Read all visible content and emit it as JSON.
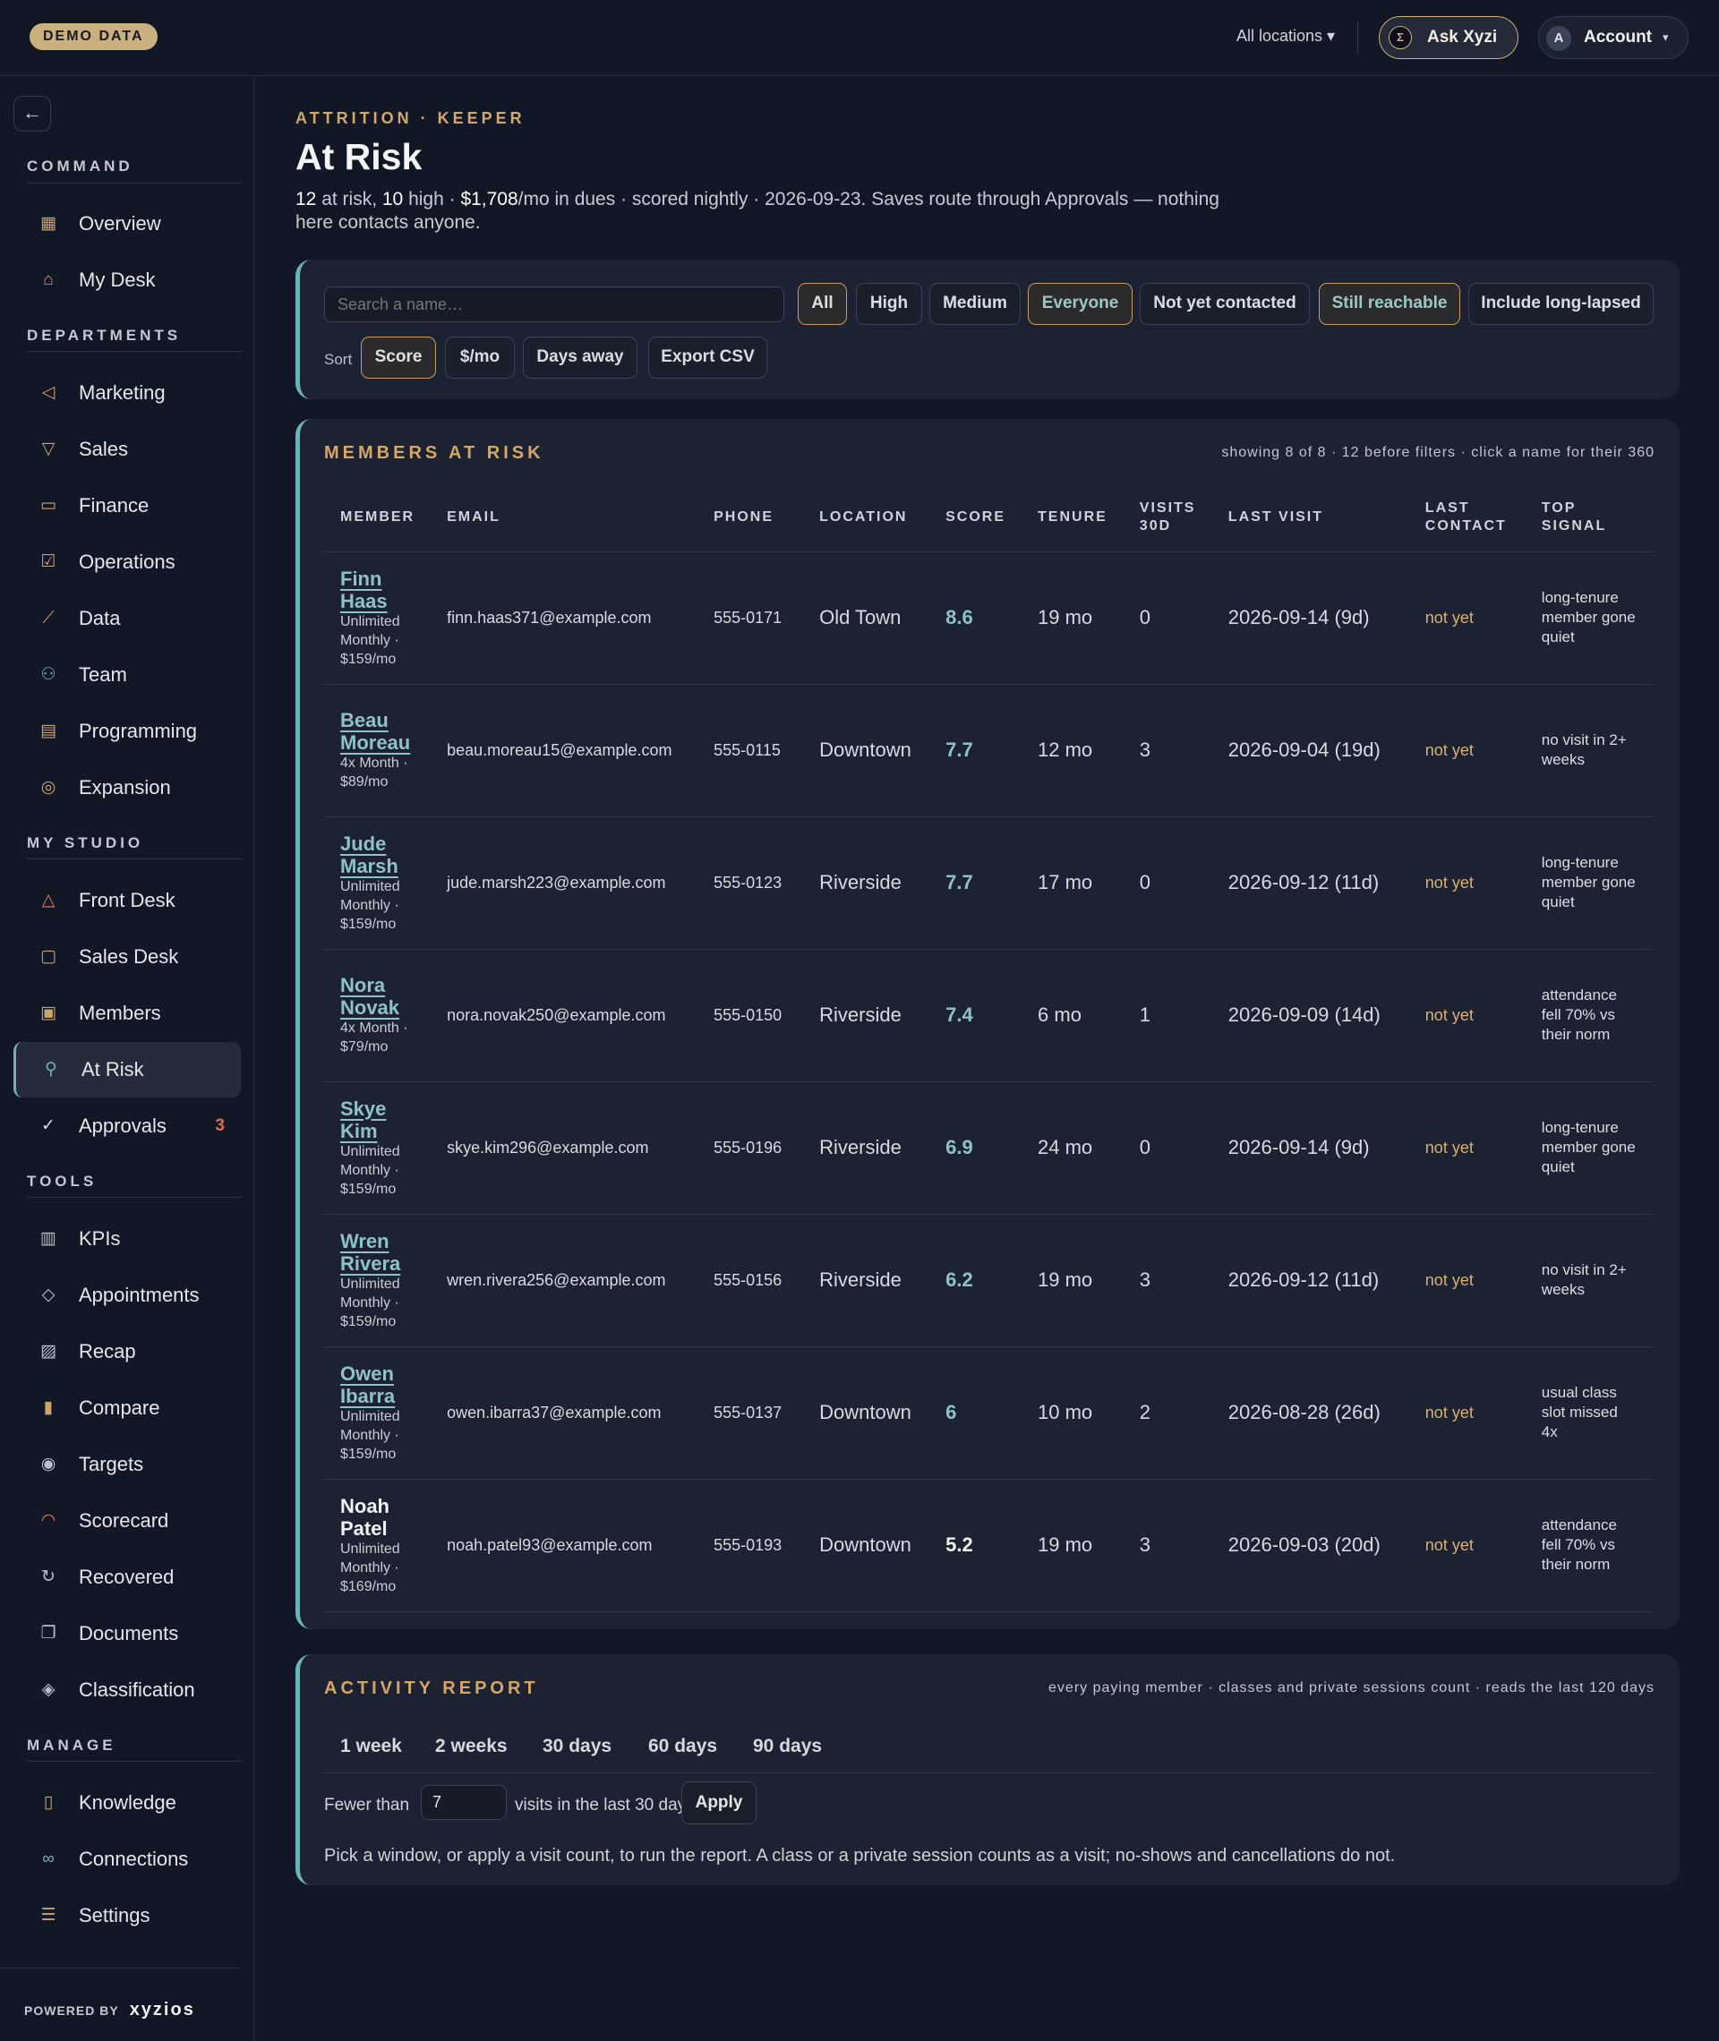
{
  "topbar": {
    "demo_badge": "DEMO DATA",
    "locations": "All locations ▾",
    "ask_label": "Ask Xyzi",
    "account_initial": "A",
    "account_label": "Account",
    "account_caret": "▾"
  },
  "sidebar": {
    "back_icon": "←",
    "sections": {
      "command": "COMMAND",
      "departments": "DEPARTMENTS",
      "my_studio": "MY STUDIO",
      "tools": "TOOLS",
      "manage": "MANAGE"
    },
    "items": [
      {
        "label": "Overview",
        "icon": "grid-icon"
      },
      {
        "label": "My Desk",
        "icon": "inbox-icon"
      },
      {
        "label": "Marketing",
        "icon": "megaphone-icon"
      },
      {
        "label": "Sales",
        "icon": "funnel-icon"
      },
      {
        "label": "Finance",
        "icon": "banknote-icon"
      },
      {
        "label": "Operations",
        "icon": "clipboard-check-icon"
      },
      {
        "label": "Data",
        "icon": "line-chart-icon"
      },
      {
        "label": "Team",
        "icon": "users-icon"
      },
      {
        "label": "Programming",
        "icon": "calendar-icon"
      },
      {
        "label": "Expansion",
        "icon": "compass-icon"
      },
      {
        "label": "Front Desk",
        "icon": "bell-icon"
      },
      {
        "label": "Sales Desk",
        "icon": "chat-icon"
      },
      {
        "label": "Members",
        "icon": "id-card-icon"
      },
      {
        "label": "At Risk",
        "icon": "user-alert-icon"
      },
      {
        "label": "Approvals",
        "icon": "check-circle-icon",
        "badge": "3"
      },
      {
        "label": "KPIs",
        "icon": "bar-chart-icon"
      },
      {
        "label": "Appointments",
        "icon": "layers-icon"
      },
      {
        "label": "Recap",
        "icon": "trend-file-icon"
      },
      {
        "label": "Compare",
        "icon": "columns-chart-icon"
      },
      {
        "label": "Targets",
        "icon": "target-icon"
      },
      {
        "label": "Scorecard",
        "icon": "gauge-icon"
      },
      {
        "label": "Recovered",
        "icon": "refresh-icon"
      },
      {
        "label": "Documents",
        "icon": "documents-icon"
      },
      {
        "label": "Classification",
        "icon": "tag-icon"
      },
      {
        "label": "Knowledge",
        "icon": "book-icon"
      },
      {
        "label": "Connections",
        "icon": "link-icon"
      },
      {
        "label": "Settings",
        "icon": "sliders-icon"
      }
    ],
    "powered_by": "POWERED BY",
    "brand": "xyzios"
  },
  "header": {
    "eyebrow": "ATTRITION · KEEPER",
    "title": "At Risk",
    "subtitle_a": "12",
    "subtitle_b": " at risk, ",
    "subtitle_c": "10",
    "subtitle_d": " high · ",
    "subtitle_e": "$1,708",
    "subtitle_f": "/mo in dues · scored nightly · 2026-09-23. Saves route through Approvals — nothing here contacts anyone."
  },
  "filters": {
    "search_placeholder": "Search a name…",
    "chips": [
      "All",
      "High",
      "Medium",
      "Everyone",
      "Not yet contacted",
      "Still reachable",
      "Include long-lapsed"
    ],
    "sort_label": "Sort",
    "sort_chips": [
      "Score",
      "$/mo",
      "Days away",
      "Export CSV"
    ]
  },
  "members": {
    "title": "MEMBERS AT RISK",
    "note": "showing 8 of 8 · 12 before filters · click a name for their 360",
    "columns": [
      "MEMBER",
      "EMAIL",
      "PHONE",
      "LOCATION",
      "SCORE",
      "TENURE",
      "VISITS 30D",
      "LAST VISIT",
      "LAST CONTACT",
      "TOP SIGNAL"
    ],
    "rows": [
      {
        "first": "Finn",
        "last": "Haas",
        "plan": "Unlimited Monthly · $159/mo",
        "email": "finn.haas371@example.com",
        "phone": "555-0171",
        "location": "Old Town",
        "score": "8.6",
        "tenure": "19 mo",
        "visits": "0",
        "last_visit": "2026-09-14 (9d)",
        "last_contact": "not yet",
        "signal": "long-tenure member gone quiet"
      },
      {
        "first": "Beau",
        "last": "Moreau",
        "plan": "4x Month · $89/mo",
        "email": "beau.moreau15@example.com",
        "phone": "555-0115",
        "location": "Downtown",
        "score": "7.7",
        "tenure": "12 mo",
        "visits": "3",
        "last_visit": "2026-09-04 (19d)",
        "last_contact": "not yet",
        "signal": "no visit in 2+ weeks"
      },
      {
        "first": "Jude",
        "last": "Marsh",
        "plan": "Unlimited Monthly · $159/mo",
        "email": "jude.marsh223@example.com",
        "phone": "555-0123",
        "location": "Riverside",
        "score": "7.7",
        "tenure": "17 mo",
        "visits": "0",
        "last_visit": "2026-09-12 (11d)",
        "last_contact": "not yet",
        "signal": "long-tenure member gone quiet"
      },
      {
        "first": "Nora",
        "last": "Novak",
        "plan": "4x Month · $79/mo",
        "email": "nora.novak250@example.com",
        "phone": "555-0150",
        "location": "Riverside",
        "score": "7.4",
        "tenure": "6 mo",
        "visits": "1",
        "last_visit": "2026-09-09 (14d)",
        "last_contact": "not yet",
        "signal": "attendance fell 70% vs their norm"
      },
      {
        "first": "Skye",
        "last": "Kim",
        "plan": "Unlimited Monthly · $159/mo",
        "email": "skye.kim296@example.com",
        "phone": "555-0196",
        "location": "Riverside",
        "score": "6.9",
        "tenure": "24 mo",
        "visits": "0",
        "last_visit": "2026-09-14 (9d)",
        "last_contact": "not yet",
        "signal": "long-tenure member gone quiet"
      },
      {
        "first": "Wren",
        "last": "Rivera",
        "plan": "Unlimited Monthly · $159/mo",
        "email": "wren.rivera256@example.com",
        "phone": "555-0156",
        "location": "Riverside",
        "score": "6.2",
        "tenure": "19 mo",
        "visits": "3",
        "last_visit": "2026-09-12 (11d)",
        "last_contact": "not yet",
        "signal": "no visit in 2+ weeks"
      },
      {
        "first": "Owen",
        "last": "Ibarra",
        "plan": "Unlimited Monthly · $159/mo",
        "email": "owen.ibarra37@example.com",
        "phone": "555-0137",
        "location": "Downtown",
        "score": "6",
        "tenure": "10 mo",
        "visits": "2",
        "last_visit": "2026-08-28 (26d)",
        "last_contact": "not yet",
        "signal": "usual class slot missed 4x"
      },
      {
        "first": "Noah",
        "last": "Patel",
        "plan": "Unlimited Monthly · $169/mo",
        "email": "noah.patel93@example.com",
        "phone": "555-0193",
        "location": "Downtown",
        "score": "5.2",
        "tenure": "19 mo",
        "visits": "3",
        "last_visit": "2026-09-03 (20d)",
        "last_contact": "not yet",
        "signal": "attendance fell 70% vs their norm"
      }
    ]
  },
  "activity": {
    "title": "ACTIVITY REPORT",
    "note": "every paying member · classes and private sessions count · reads the last 120 days",
    "tabs": [
      "1 week",
      "2 weeks",
      "30 days",
      "60 days",
      "90 days"
    ],
    "fewer_than": "Fewer than",
    "visit_value": "7",
    "after_input": "visits in the last 30 days",
    "apply": "Apply",
    "hint": "Pick a window, or apply a visit count, to run the report. A class or a private session counts as a visit; no-shows and cancellations do not."
  }
}
